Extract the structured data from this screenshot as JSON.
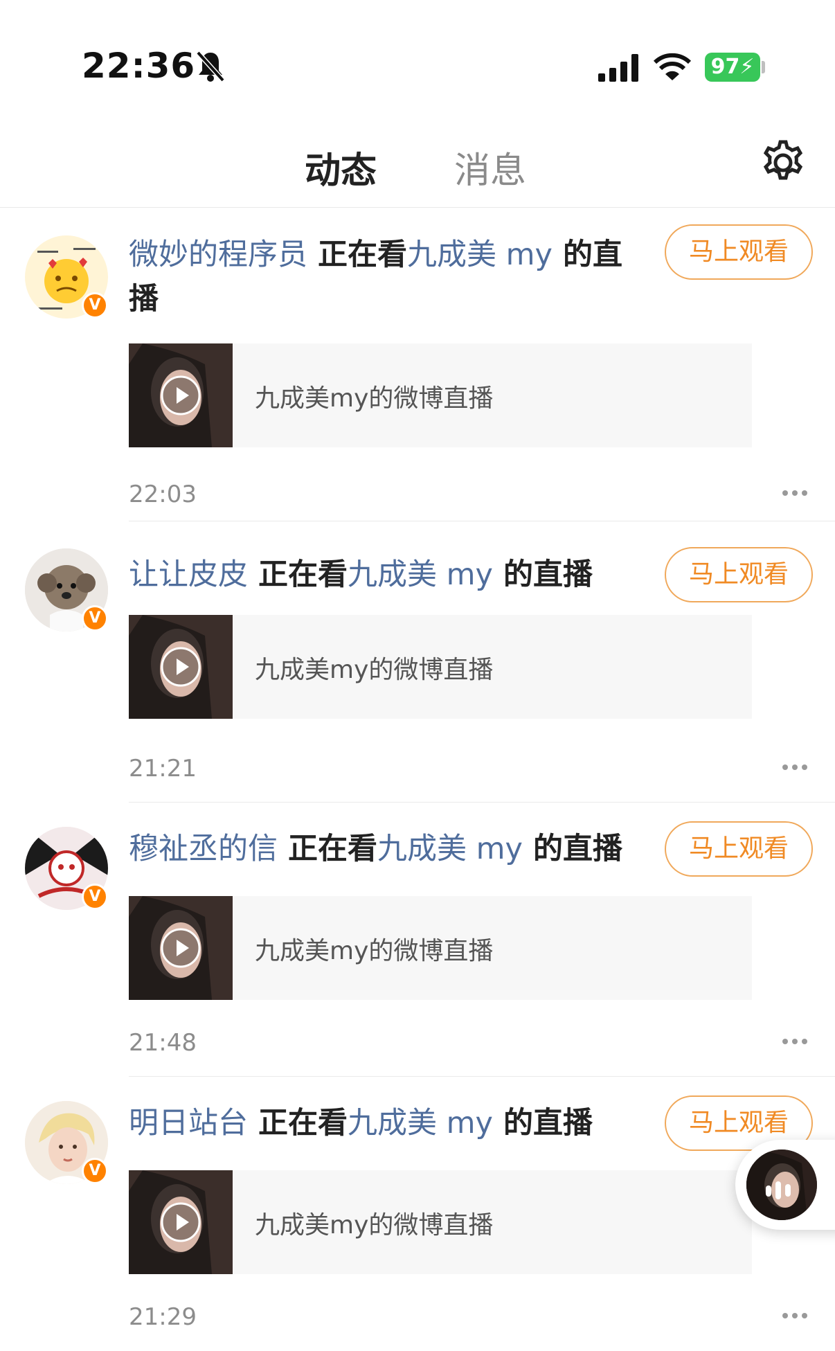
{
  "status_bar": {
    "time": "22:36",
    "battery": "97",
    "icons": [
      "bell-slash-icon",
      "signal-icon",
      "wifi-icon",
      "battery-charging-icon"
    ]
  },
  "tabs": {
    "active": "动态",
    "inactive": "消息",
    "settings_icon": "gear-icon"
  },
  "colors": {
    "accent": "#ff8200",
    "link_blue": "#4f6d9c",
    "verified": "#ff8200"
  },
  "feed": [
    {
      "user": "微妙的程序员",
      "action": "正在看",
      "streamer": "九成美 my",
      "suffix": "的直播",
      "button": "马上观看",
      "live_title": "九成美my的微博直播",
      "time": "22:03"
    },
    {
      "user": "让让皮皮",
      "action": "正在看",
      "streamer": "九成美 my",
      "suffix": "的直播",
      "button": "马上观看",
      "live_title": "九成美my的微博直播",
      "time": "21:21"
    },
    {
      "user": "穆祉丞的信",
      "action": "正在看",
      "streamer": "九成美 my",
      "suffix": "的直播",
      "button": "马上观看",
      "live_title": "九成美my的微博直播",
      "time": "21:48"
    },
    {
      "user": "明日站台",
      "action": "正在看",
      "streamer": "九成美 my",
      "suffix": "的直播",
      "button": "马上观看",
      "live_title": "九成美my的微博直播",
      "time": "21:29"
    }
  ],
  "verified_badge": "V"
}
